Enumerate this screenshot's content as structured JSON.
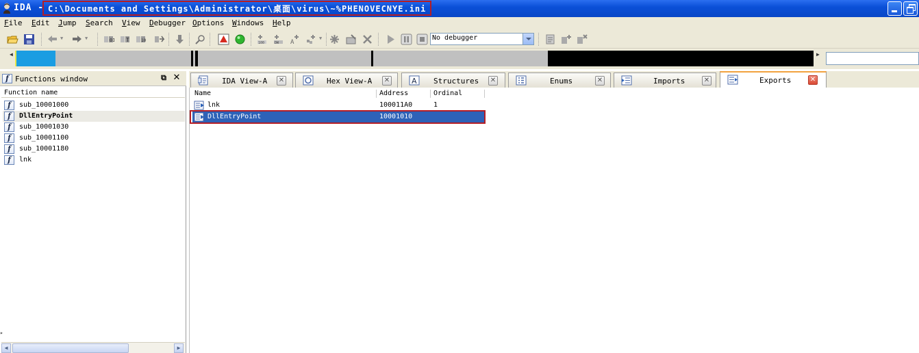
{
  "window": {
    "app_name": "IDA",
    "separator": " - ",
    "file_path": "C:\\Documents and Settings\\Administrator\\桌面\\virus\\~%PHENOVECNYE.ini"
  },
  "menu": [
    "File",
    "Edit",
    "Jump",
    "Search",
    "View",
    "Debugger",
    "Options",
    "Windows",
    "Help"
  ],
  "toolbar": {
    "debugger_select": "No debugger"
  },
  "functions_window": {
    "title": "Functions window",
    "column_header": "Function name",
    "items": [
      "sub_10001000",
      "DllEntryPoint",
      "sub_10001030",
      "sub_10001100",
      "sub_10001180",
      "lnk"
    ],
    "selected_index": 1
  },
  "tabs": [
    {
      "label": "IDA View-A",
      "icon": "ida-view-icon"
    },
    {
      "label": "Hex View-A",
      "icon": "hex-view-icon"
    },
    {
      "label": "Structures",
      "icon": "structures-icon"
    },
    {
      "label": "Enums",
      "icon": "enums-icon"
    },
    {
      "label": "Imports",
      "icon": "imports-icon"
    },
    {
      "label": "Exports",
      "icon": "exports-icon",
      "active": true
    }
  ],
  "exports": {
    "columns": [
      "Name",
      "Address",
      "Ordinal"
    ],
    "rows": [
      {
        "name": "lnk",
        "address": "100011A0",
        "ordinal": "1"
      },
      {
        "name": "DllEntryPoint",
        "address": "10001010",
        "ordinal": ""
      }
    ],
    "selected_index": 1
  },
  "colors": {
    "titlebar": "#0b50d8",
    "highlight_box": "#b51d25",
    "selection": "#2d62b8",
    "navigator_code": "#1a9de2",
    "navigator_data": "#000000"
  }
}
